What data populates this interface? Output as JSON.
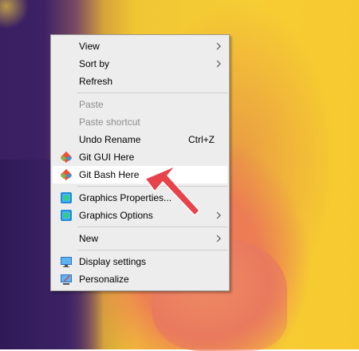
{
  "menu": {
    "items": [
      {
        "label": "View",
        "submenu": true
      },
      {
        "label": "Sort by",
        "submenu": true
      },
      {
        "label": "Refresh"
      },
      {
        "label": "Paste",
        "disabled": true
      },
      {
        "label": "Paste shortcut",
        "disabled": true
      },
      {
        "label": "Undo Rename",
        "shortcut": "Ctrl+Z"
      },
      {
        "label": "Git GUI Here",
        "icon": "git-icon"
      },
      {
        "label": "Git Bash Here",
        "icon": "git-icon",
        "highlighted": true
      },
      {
        "label": "Graphics Properties...",
        "icon": "intel-graphics-icon"
      },
      {
        "label": "Graphics Options",
        "icon": "intel-graphics-icon",
        "submenu": true
      },
      {
        "label": "New",
        "submenu": true
      },
      {
        "label": "Display settings",
        "icon": "display-settings-icon"
      },
      {
        "label": "Personalize",
        "icon": "personalize-icon"
      }
    ]
  },
  "colors": {
    "menu_bg": "#ededed",
    "highlight_bg": "#ffffff",
    "arrow": "#e8424b",
    "disabled_text": "#8d8d8d"
  }
}
